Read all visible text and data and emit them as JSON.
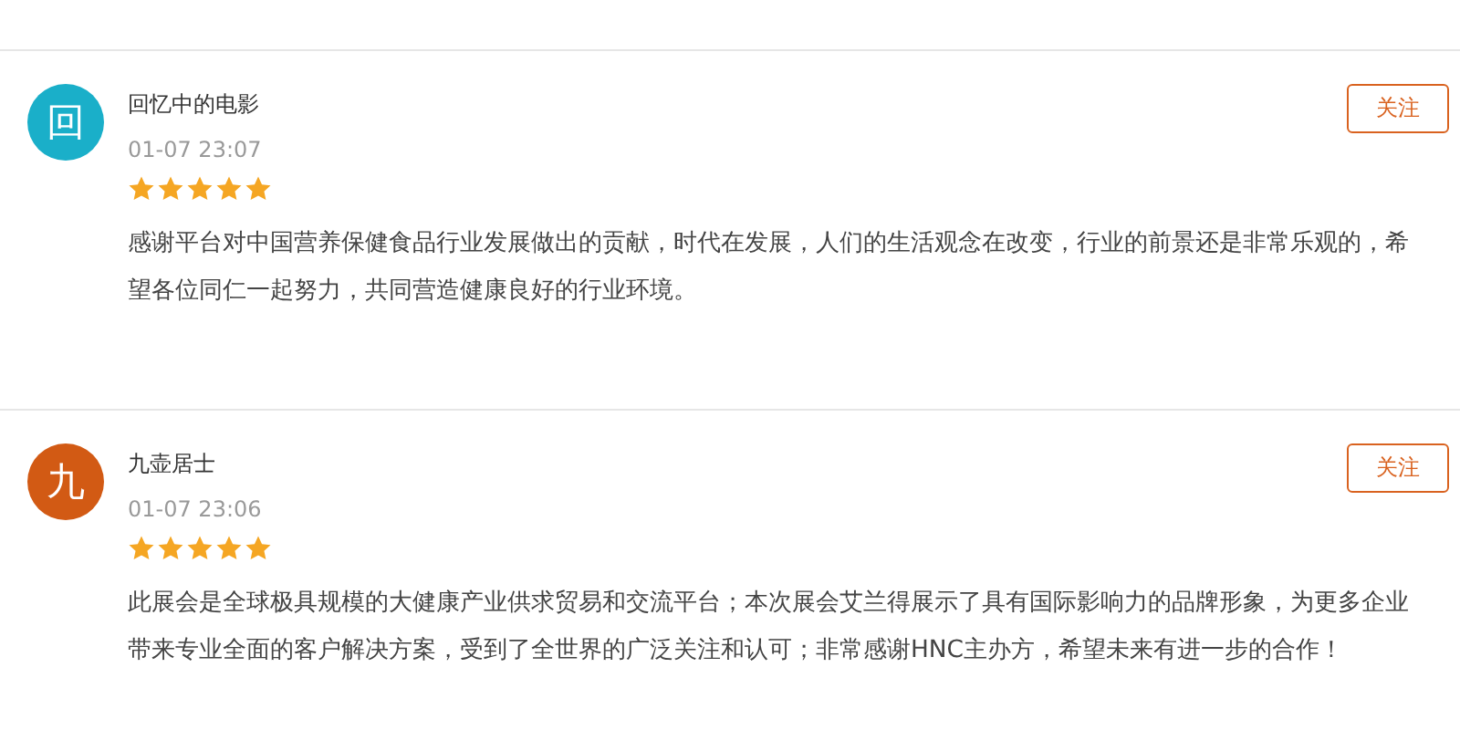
{
  "comments": [
    {
      "avatar": {
        "letter": "回",
        "color": "#1aafc9"
      },
      "name": "回忆中的电影",
      "time": "01-07 23:07",
      "stars": 5,
      "follow": "关注",
      "text": "感谢平台对中国营养保健食品行业发展做出的贡献，时代在发展，人们的生活观念在改变，行业的前景还是非常乐观的，希望各位同仁一起努力，共同营造健康良好的行业环境。"
    },
    {
      "avatar": {
        "letter": "九",
        "color": "#d25a14"
      },
      "name": "九壶居士",
      "time": "01-07 23:06",
      "stars": 5,
      "follow": "关注",
      "text": "此展会是全球极具规模的大健康产业供求贸易和交流平台；本次展会艾兰得展示了具有国际影响力的品牌形象，为更多企业带来专业全面的客户解决方案，受到了全世界的广泛关注和认可；非常感谢HNC主办方，希望未来有进一步的合作！"
    }
  ]
}
